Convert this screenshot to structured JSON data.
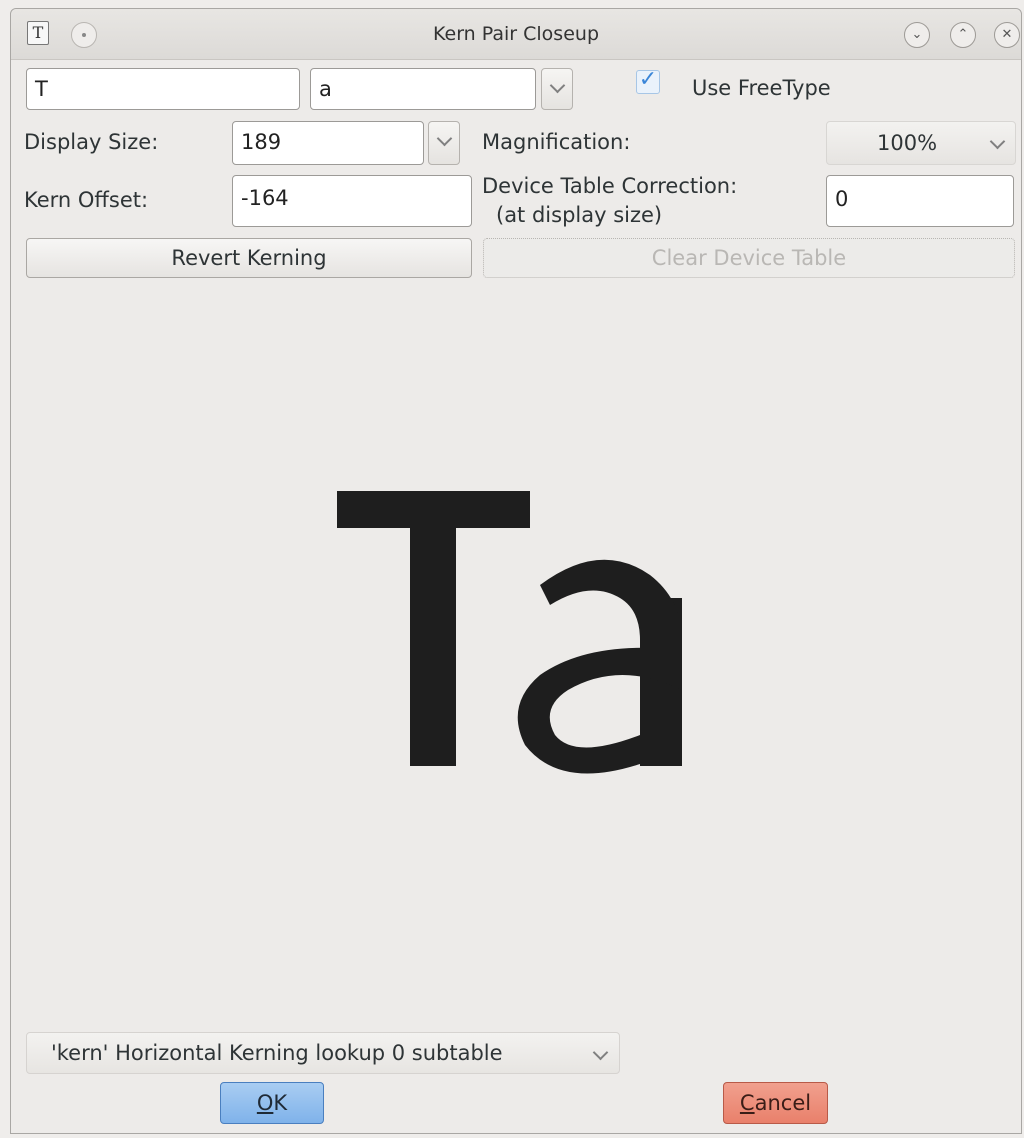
{
  "window": {
    "title": "Kern Pair Closeup",
    "app_icon_glyph": "T",
    "titlebar_buttons": [
      "minimize",
      "maximize",
      "close"
    ]
  },
  "glyph_inputs": {
    "first": "T",
    "second": "a"
  },
  "use_freetype": {
    "label": "Use FreeType",
    "checked": true
  },
  "display_size": {
    "label": "Display Size:",
    "value": "189"
  },
  "magnification": {
    "label": "Magnification:",
    "value": "100%"
  },
  "kern_offset": {
    "label": "Kern Offset:",
    "value": "-164"
  },
  "device_table": {
    "label_line1": "Device Table Correction:",
    "label_line2": "(at display size)",
    "value": "0"
  },
  "buttons": {
    "revert": "Revert Kerning",
    "clear_device_table": "Clear Device Table",
    "ok_mnemonic": "O",
    "ok_rest": "K",
    "cancel_mnemonic": "C",
    "cancel_rest": "ancel"
  },
  "preview": {
    "text": "Ta",
    "color": "#1e1e1e"
  },
  "lookup": {
    "value": "'kern' Horizontal Kerning lookup 0 subtable"
  },
  "colors": {
    "ok_button": "#7fb2ea",
    "cancel_button": "#e9806b",
    "checkbox_accent": "#3b86d8"
  }
}
